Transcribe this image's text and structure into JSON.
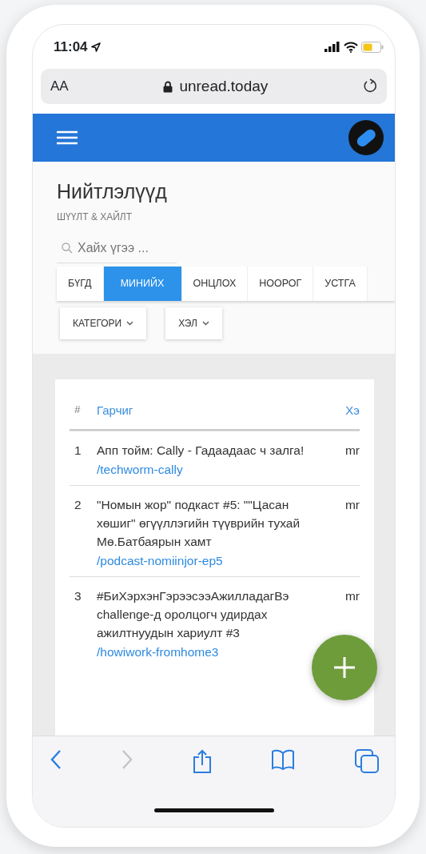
{
  "status_bar": {
    "time": "11:04"
  },
  "address_bar": {
    "text_size": "AA",
    "url": "unread.today"
  },
  "page": {
    "title": "Нийтлэлүүд",
    "subtitle": "ШҮҮЛТ & ХАЙЛТ",
    "search": {
      "placeholder": "Хайх үгээ ..."
    },
    "tabs": [
      {
        "label": "БҮГД",
        "selected": false
      },
      {
        "label": "МИНИЙХ",
        "selected": true
      },
      {
        "label": "ОНЦЛОХ",
        "selected": false
      },
      {
        "label": "НООРОГ",
        "selected": false
      },
      {
        "label": "УСТГА",
        "selected": false
      }
    ],
    "dropdowns": [
      "КАТЕГОРИ",
      "ХЭЛ"
    ]
  },
  "table": {
    "columns": [
      "#",
      "Гарчиг",
      "Хэ"
    ],
    "rows": [
      {
        "number": "1",
        "title": "Апп тойм: Cally - Гадаадаас ч залга!",
        "slug": "/techworm-cally",
        "column_3": "mr"
      },
      {
        "number": "2",
        "title": "\"Номын жор\" подкаст #5: \"\"Цасан хөшиг\" өгүүллэгийн түүврийн тухай Мө.Батбаярын хамт",
        "slug": "/podcast-nomiinjor-ep5",
        "column_3": "mr"
      },
      {
        "number": "3",
        "title": "#БиХэрхэнГэрээсээАжилладагВэ challenge-д оролцогч удирдах ажилтнуудын хариулт #3",
        "slug": "/howiwork-fromhome3",
        "column_3": "mr"
      }
    ]
  },
  "toolbar": {
    "back_enabled": true,
    "forward_enabled": false
  }
}
